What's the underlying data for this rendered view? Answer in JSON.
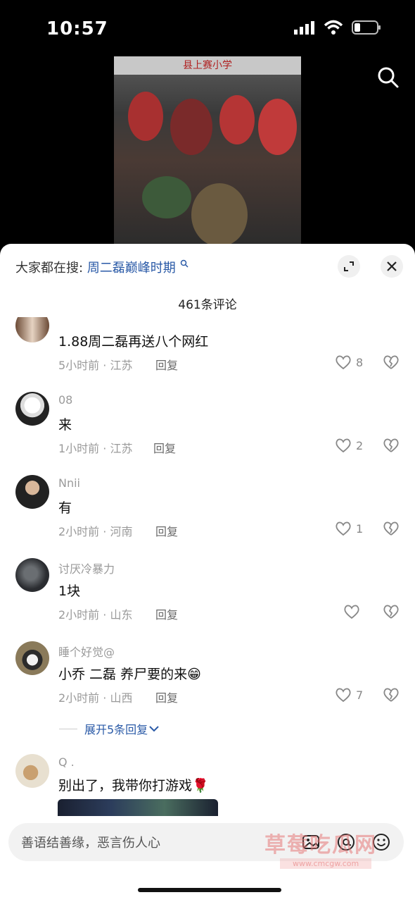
{
  "status_bar": {
    "time": "10:57",
    "icons": [
      "signal-icon",
      "wifi-icon",
      "battery-icon"
    ]
  },
  "video": {
    "banner_text": "县上赛小学"
  },
  "sheet": {
    "search_prefix": "大家都在搜:",
    "search_term": "周二磊巅峰时期",
    "comment_count": "461条评论"
  },
  "comments": [
    {
      "name": "",
      "text": "1.88周二磊再送八个网红",
      "time_loc": "5小时前 · 江苏",
      "reply": "回复",
      "likes": "8"
    },
    {
      "name": "08",
      "text": "来",
      "time_loc": "1小时前 · 江苏",
      "reply": "回复",
      "likes": "2"
    },
    {
      "name": "Nnii",
      "text": "有",
      "time_loc": "2小时前 · 河南",
      "reply": "回复",
      "likes": "1"
    },
    {
      "name": "讨厌冷暴力",
      "text": "1块",
      "time_loc": "2小时前 · 山东",
      "reply": "回复",
      "likes": ""
    },
    {
      "name": "睡个好觉@",
      "text": "小乔 二磊 养尸要的来😁",
      "time_loc": "2小时前 · 山西",
      "reply": "回复",
      "likes": "7"
    },
    {
      "name": "Q .",
      "text": "别出了，我带你打游戏🌹"
    }
  ],
  "expand_replies": "展开5条回复",
  "input": {
    "placeholder": "善语结善缘，恶言伤人心"
  },
  "watermark": {
    "main": "草莓吃瓜网",
    "sub": "www.cmcgw.com"
  },
  "colors": {
    "link": "#2a5aa7",
    "muted": "#9a9a9a",
    "sheet_bg": "#ffffff",
    "page_bg": "#000000"
  }
}
